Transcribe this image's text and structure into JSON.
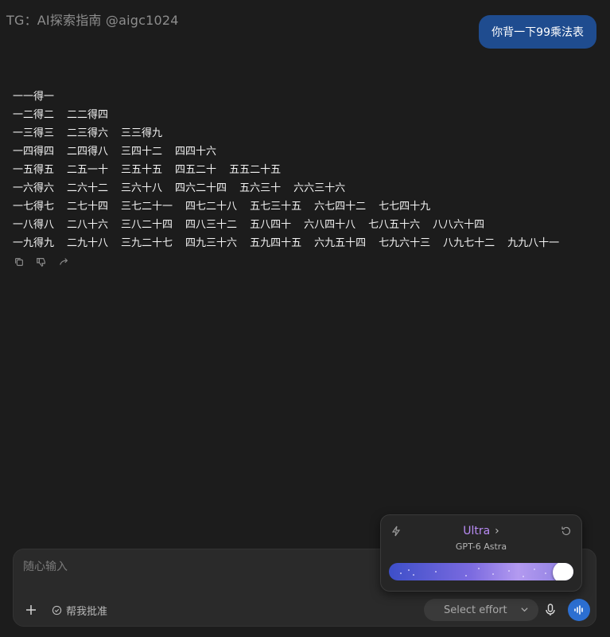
{
  "watermark": "TG：AI探索指南 @aigc1024",
  "user_message": "你背一下99乘法表",
  "answer_rows": [
    [
      "一一得一"
    ],
    [
      "一二得二",
      "二二得四"
    ],
    [
      "一三得三",
      "二三得六",
      "三三得九"
    ],
    [
      "一四得四",
      "二四得八",
      "三四十二",
      "四四十六"
    ],
    [
      "一五得五",
      "二五一十",
      "三五十五",
      "四五二十",
      "五五二十五"
    ],
    [
      "一六得六",
      "二六十二",
      "三六十八",
      "四六二十四",
      "五六三十",
      "六六三十六"
    ],
    [
      "一七得七",
      "二七十四",
      "三七二十一",
      "四七二十八",
      "五七三十五",
      "六七四十二",
      "七七四十九"
    ],
    [
      "一八得八",
      "二八十六",
      "三八二十四",
      "四八三十二",
      "五八四十",
      "六八四十八",
      "七八五十六",
      "八八六十四"
    ],
    [
      "一九得九",
      "二九十八",
      "三九二十七",
      "四九三十六",
      "五九四十五",
      "六九五十四",
      "七九六十三",
      "八九七十二",
      "九九八十一"
    ]
  ],
  "actions": [
    {
      "name": "copy-icon"
    },
    {
      "name": "thumbs-down-icon"
    },
    {
      "name": "share-icon"
    }
  ],
  "composer": {
    "placeholder": "随心输入",
    "helper_label": "帮我批准",
    "effort_label": "Select effort"
  },
  "model_popup": {
    "tier": "Ultra",
    "model_name": "GPT-6 Astra",
    "effort_level": 1.0
  },
  "colors": {
    "user_bubble": "#1f4c8f",
    "tier_text": "#b98cf5",
    "voice_button": "#2c6fd1"
  }
}
